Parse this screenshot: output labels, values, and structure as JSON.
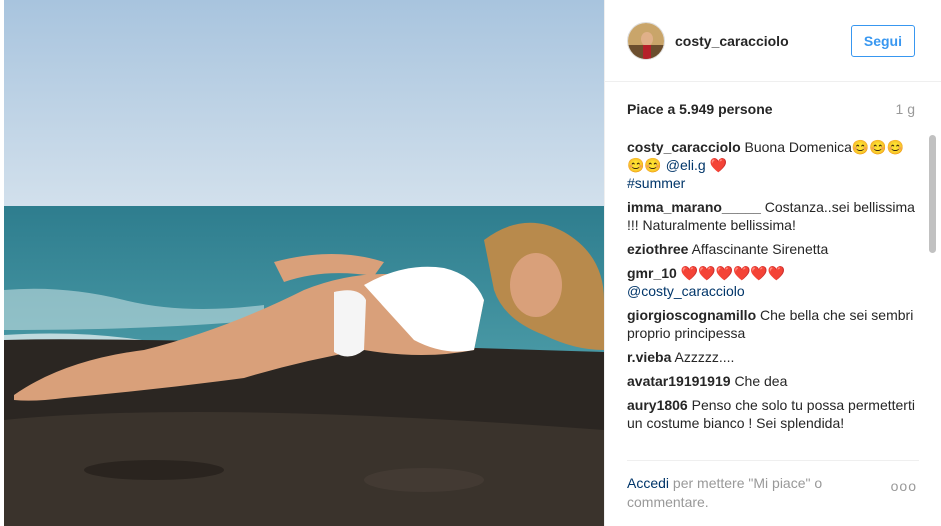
{
  "post": {
    "username": "costy_caracciolo",
    "follow_label": "Segui",
    "likes_text": "Piace a 5.949 persone",
    "age": "1 g",
    "photo_icon": "beach-photo"
  },
  "comments": [
    {
      "user": "costy_caracciolo",
      "text": "Buona Domenica",
      "emoji": "😊😊😊😊😊",
      "mention": "@eli.g",
      "heart": "❤️",
      "tag": "#summer"
    },
    {
      "user": "imma_marano_____",
      "text": "Costanza..sei bellissima !!! Naturalmente bellissima!"
    },
    {
      "user": "eziothree",
      "text": "Affascinante Sirenetta"
    },
    {
      "user": "gmr_10",
      "text": "❤️❤️❤️❤️❤️❤️",
      "mention": "@costy_caracciolo"
    },
    {
      "user": "giorgioscognamillo",
      "text": "Che bella che sei sembri proprio principessa"
    },
    {
      "user": "r.vieba",
      "text": "Azzzzz...."
    },
    {
      "user": "avatar19191919",
      "text": "Che dea"
    },
    {
      "user": "aury1806",
      "text": "Penso che solo tu possa permetterti un costume bianco ! Sei splendida!"
    }
  ],
  "footer": {
    "login_label": "Accedi",
    "prompt_text": "per mettere \"Mi piace\" o commentare.",
    "more_label": "ooo"
  },
  "colors": {
    "link": "#003569",
    "follow_blue": "#3897f0",
    "muted": "#999999"
  }
}
